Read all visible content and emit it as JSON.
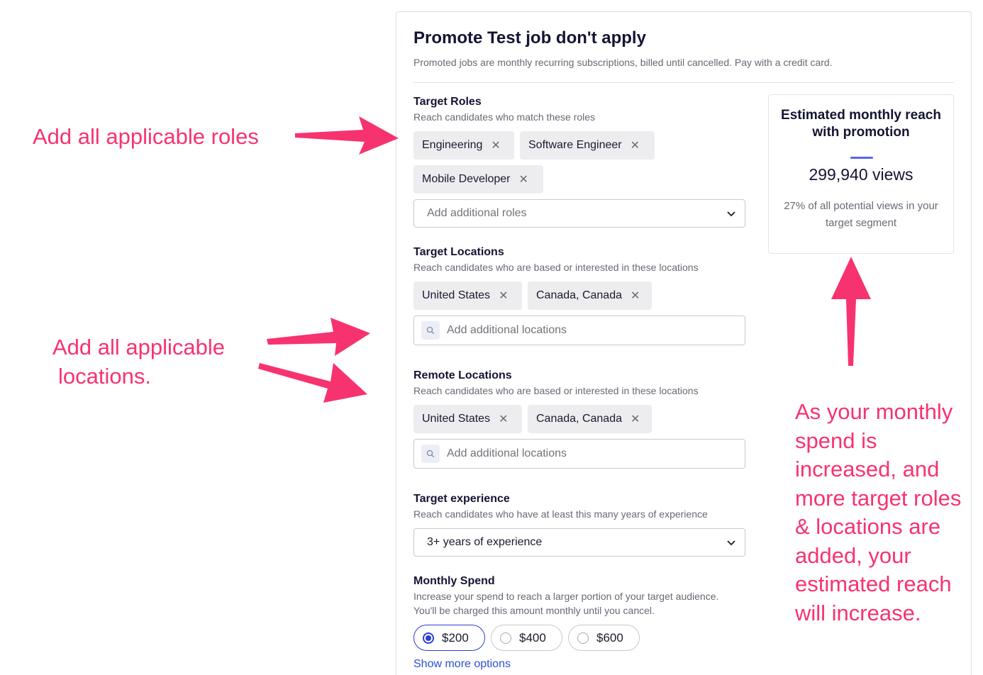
{
  "modal": {
    "title": "Promote Test job don't apply",
    "subtitle": "Promoted jobs are monthly recurring subscriptions, billed until cancelled. Pay with a credit card."
  },
  "target_roles": {
    "label": "Target Roles",
    "help": "Reach candidates who match these roles",
    "chips": [
      "Engineering",
      "Software Engineer",
      "Mobile Developer"
    ],
    "remove_glyph": "✕",
    "placeholder": "Add additional roles"
  },
  "target_locations": {
    "label": "Target Locations",
    "help": "Reach candidates who are based or interested in these locations",
    "chips": [
      "United States",
      "Canada, Canada"
    ],
    "placeholder": "Add additional locations"
  },
  "remote_locations": {
    "label": "Remote Locations",
    "help": "Reach candidates who are based or interested in these locations",
    "chips": [
      "United States",
      "Canada, Canada"
    ],
    "placeholder": "Add additional locations"
  },
  "target_experience": {
    "label": "Target experience",
    "help": "Reach candidates who have at least this many years of experience",
    "value": "3+ years of experience"
  },
  "monthly_spend": {
    "label": "Monthly Spend",
    "help_line1": "Increase your spend to reach a larger portion of your target audience.",
    "help_line2": "You'll be charged this amount monthly until you cancel.",
    "options": [
      "$200",
      "$400",
      "$600"
    ],
    "selected": "$200",
    "more_link": "Show more options"
  },
  "reach": {
    "title": "Estimated monthly reach with promotion",
    "views": "299,940 views",
    "description": "27% of all potential views in your target segment"
  },
  "annotations": {
    "roles": "Add all applicable roles",
    "locations_line1": "Add all applicable",
    "locations_line2": "locations.",
    "reach_lines": [
      "As your monthly",
      "spend is",
      "increased, and",
      "more target roles",
      "& locations are",
      "added, your",
      "estimated reach",
      "will increase."
    ]
  },
  "colors": {
    "accent": "#2a3fd6",
    "annotation": "#f7336f",
    "chip_bg": "#ededf0",
    "reach_bar": "#5a64f0"
  }
}
